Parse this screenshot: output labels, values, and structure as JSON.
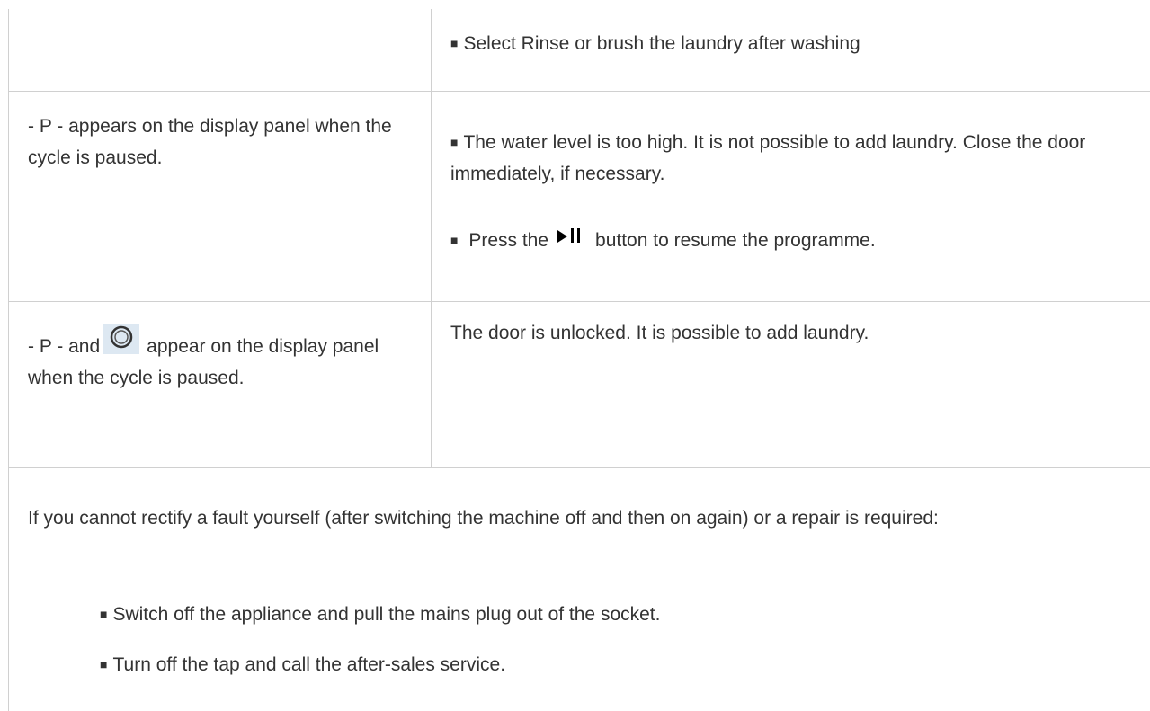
{
  "table": {
    "row1": {
      "right": "Select Rinse or brush the laundry after washing"
    },
    "row2": {
      "left": "- P - appears on the display panel when the cycle is paused.",
      "right_line1": "The water level is too high. It is not possible to add laundry. Close the door immediately, if necessary.",
      "right_line2_before": "Press the",
      "right_line2_icon": "play-pause-icon",
      "right_line2_after": "button to resume the programme."
    },
    "row3": {
      "left_before": "- P - and",
      "left_icon": "door-unlocked-icon",
      "left_after": "appear on the display panel when the cycle is paused.",
      "right": "The door is unlocked. It is possible to add laundry."
    }
  },
  "footer": {
    "intro": "If you cannot rectify a fault yourself (after switching the machine off and then on again) or a repair is required:",
    "steps": [
      "Switch off the appliance and pull the mains plug out of the socket.",
      "Turn off the tap and call the after-sales service."
    ]
  }
}
